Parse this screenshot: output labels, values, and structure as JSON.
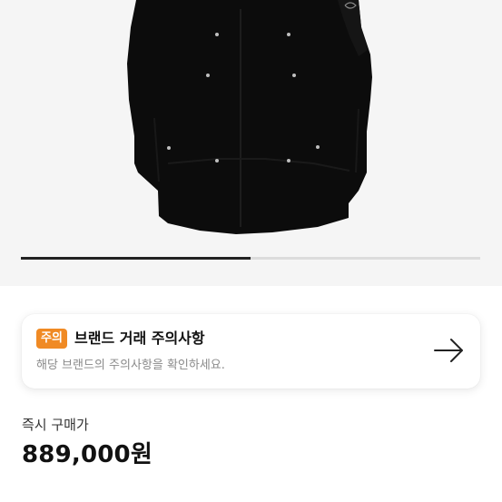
{
  "gallery": {
    "image_icon": "black-padded-parka-jacket",
    "progress_fraction": 0.5
  },
  "notice": {
    "badge": "주의",
    "title": "브랜드 거래 주의사항",
    "subtitle": "해당 브랜드의 주의사항을 확인하세요.",
    "arrow_icon": "arrow-right-icon",
    "badge_color": "#f08a24"
  },
  "purchase": {
    "label": "즉시 구매가",
    "price": "889,000원"
  }
}
